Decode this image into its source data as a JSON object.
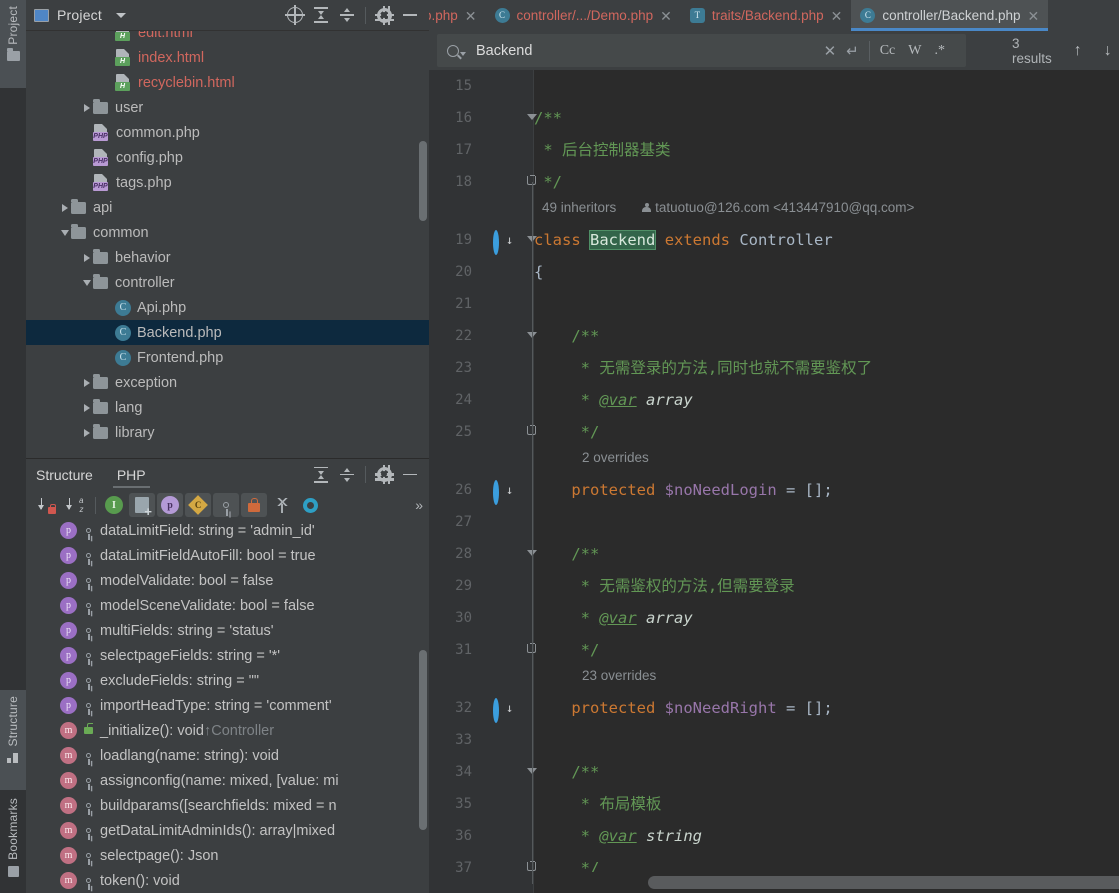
{
  "rail": {
    "project": "Project",
    "structure": "Structure",
    "bookmarks": "Bookmarks"
  },
  "project_panel": {
    "title": "Project",
    "icons": [
      "locate-icon",
      "expand-all-icon",
      "collapse-all-icon",
      "gear-icon",
      "minimize-icon"
    ],
    "tree": [
      {
        "label": "edit.html",
        "type": "html",
        "depth": 3,
        "arrow": "none",
        "selected": false,
        "partial": true
      },
      {
        "label": "index.html",
        "type": "html",
        "depth": 3,
        "arrow": "none",
        "selected": false
      },
      {
        "label": "recyclebin.html",
        "type": "html",
        "depth": 3,
        "arrow": "none",
        "selected": false
      },
      {
        "label": "user",
        "type": "folder",
        "depth": 2,
        "arrow": "right",
        "selected": false
      },
      {
        "label": "common.php",
        "type": "php",
        "depth": 2,
        "arrow": "none",
        "selected": false
      },
      {
        "label": "config.php",
        "type": "php",
        "depth": 2,
        "arrow": "none",
        "selected": false
      },
      {
        "label": "tags.php",
        "type": "php",
        "depth": 2,
        "arrow": "none",
        "selected": false
      },
      {
        "label": "api",
        "type": "folder",
        "depth": 1,
        "arrow": "right",
        "selected": false
      },
      {
        "label": "common",
        "type": "folder",
        "depth": 1,
        "arrow": "down",
        "selected": false
      },
      {
        "label": "behavior",
        "type": "folder",
        "depth": 2,
        "arrow": "right",
        "selected": false
      },
      {
        "label": "controller",
        "type": "folder",
        "depth": 2,
        "arrow": "down",
        "selected": false
      },
      {
        "label": "Api.php",
        "type": "class",
        "depth": 3,
        "arrow": "none",
        "selected": false
      },
      {
        "label": "Backend.php",
        "type": "class",
        "depth": 3,
        "arrow": "none",
        "selected": true
      },
      {
        "label": "Frontend.php",
        "type": "class",
        "depth": 3,
        "arrow": "none",
        "selected": false
      },
      {
        "label": "exception",
        "type": "folder",
        "depth": 2,
        "arrow": "right",
        "selected": false
      },
      {
        "label": "lang",
        "type": "folder",
        "depth": 2,
        "arrow": "right",
        "selected": false
      },
      {
        "label": "library",
        "type": "folder",
        "depth": 2,
        "arrow": "right",
        "selected": false
      }
    ]
  },
  "structure_panel": {
    "tabs": [
      {
        "label": "Structure",
        "active": false
      },
      {
        "label": "PHP",
        "active": true
      }
    ],
    "header_icons": [
      "expand-all-icon",
      "collapse-all-icon",
      "gear-icon",
      "minimize-icon"
    ],
    "toolbar_icons": [
      "sort-by-visibility-icon",
      "sort-alphabetically-icon",
      "show-inherited-icon",
      "show-fields-icon",
      "show-properties-icon",
      "show-constants-icon",
      "show-non-public-icon",
      "show-private-icon",
      "show-hierarchy-icon",
      "show-interfaces-icon",
      "more-icon"
    ],
    "members": [
      {
        "kind": "p",
        "vis": "key",
        "text": "dataLimitField: string = 'admin_id'"
      },
      {
        "kind": "p",
        "vis": "key",
        "text": "dataLimitFieldAutoFill: bool = true"
      },
      {
        "kind": "p",
        "vis": "key",
        "text": "modelValidate: bool = false"
      },
      {
        "kind": "p",
        "vis": "key",
        "text": "modelSceneValidate: bool = false"
      },
      {
        "kind": "p",
        "vis": "key",
        "text": "multiFields: string = 'status'"
      },
      {
        "kind": "p",
        "vis": "key",
        "text": "selectpageFields: string = '*'"
      },
      {
        "kind": "p",
        "vis": "key",
        "text": "excludeFields: string = \"\""
      },
      {
        "kind": "p",
        "vis": "key",
        "text": "importHeadType: string = 'comment'"
      },
      {
        "kind": "m",
        "vis": "unlock",
        "text": "_initialize(): void",
        "sup": "↑Controller"
      },
      {
        "kind": "m",
        "vis": "key",
        "text": "loadlang(name: string): void"
      },
      {
        "kind": "m",
        "vis": "key",
        "text": "assignconfig(name: mixed, [value: mi"
      },
      {
        "kind": "m",
        "vis": "key",
        "text": "buildparams([searchfields: mixed = n"
      },
      {
        "kind": "m",
        "vis": "key",
        "text": "getDataLimitAdminIds(): array|mixed"
      },
      {
        "kind": "m",
        "vis": "key",
        "text": "selectpage(): Json"
      },
      {
        "kind": "m",
        "vis": "key",
        "text": "token(): void"
      }
    ]
  },
  "editor": {
    "tabs": [
      {
        "label": "o.php",
        "icon": "none",
        "active": false,
        "clipped": true
      },
      {
        "label": "controller/.../Demo.php",
        "icon": "class-icon",
        "active": false
      },
      {
        "label": "traits/Backend.php",
        "icon": "trait-icon",
        "active": false
      },
      {
        "label": "controller/Backend.php",
        "icon": "class-icon",
        "active": true
      }
    ],
    "find": {
      "query": "Backend",
      "results": "3 results",
      "options": {
        "case": "Cc",
        "words": "W",
        "regex": ".*"
      },
      "icons": [
        "search-icon",
        "clear-icon",
        "new-line-icon",
        "prev-match-icon",
        "next-match-icon",
        "select-in-editor-icon",
        "add-selection-icon"
      ]
    },
    "hints": {
      "inheritors": "49 inheritors",
      "author": "tatuotuo@126.com <413447910@qq.com>",
      "overrides_login": "2 overrides",
      "overrides_right": "23 overrides"
    },
    "lines": [
      {
        "n": 15,
        "text": ""
      },
      {
        "n": 16,
        "text": "/**",
        "fold": "tri"
      },
      {
        "n": 17,
        "text": " * 后台控制器基类"
      },
      {
        "n": 18,
        "text": " */",
        "fold": "bot"
      },
      {
        "n": 19,
        "text": "class Backend extends Controller",
        "fold": "tri",
        "breakpoint": true
      },
      {
        "n": 20,
        "text": "{"
      },
      {
        "n": 21,
        "text": ""
      },
      {
        "n": 22,
        "text": "    /**",
        "fold": "tri"
      },
      {
        "n": 23,
        "text": "     * 无需登录的方法,同时也就不需要鉴权了"
      },
      {
        "n": 24,
        "text": "     * @var array"
      },
      {
        "n": 25,
        "text": "     */",
        "fold": "bot"
      },
      {
        "n": 26,
        "text": "    protected $noNeedLogin = [];",
        "breakpoint": true
      },
      {
        "n": 27,
        "text": ""
      },
      {
        "n": 28,
        "text": "    /**",
        "fold": "tri"
      },
      {
        "n": 29,
        "text": "     * 无需鉴权的方法,但需要登录"
      },
      {
        "n": 30,
        "text": "     * @var array"
      },
      {
        "n": 31,
        "text": "     */",
        "fold": "bot"
      },
      {
        "n": 32,
        "text": "    protected $noNeedRight = [];",
        "breakpoint": true
      },
      {
        "n": 33,
        "text": ""
      },
      {
        "n": 34,
        "text": "    /**",
        "fold": "tri"
      },
      {
        "n": 35,
        "text": "     * 布局模板"
      },
      {
        "n": 36,
        "text": "     * @var string"
      },
      {
        "n": 37,
        "text": "     */",
        "fold": "bot"
      }
    ]
  },
  "colors": {
    "accent": "#4a88c7",
    "selection": "#0d293e",
    "match_highlight": "#33654a",
    "keyword": "#cc7832",
    "comment": "#629755",
    "variable": "#9876aa",
    "plain": "#a9b7c6",
    "editor_bg": "#2b2b2b",
    "panel_bg": "#3c3f41"
  }
}
